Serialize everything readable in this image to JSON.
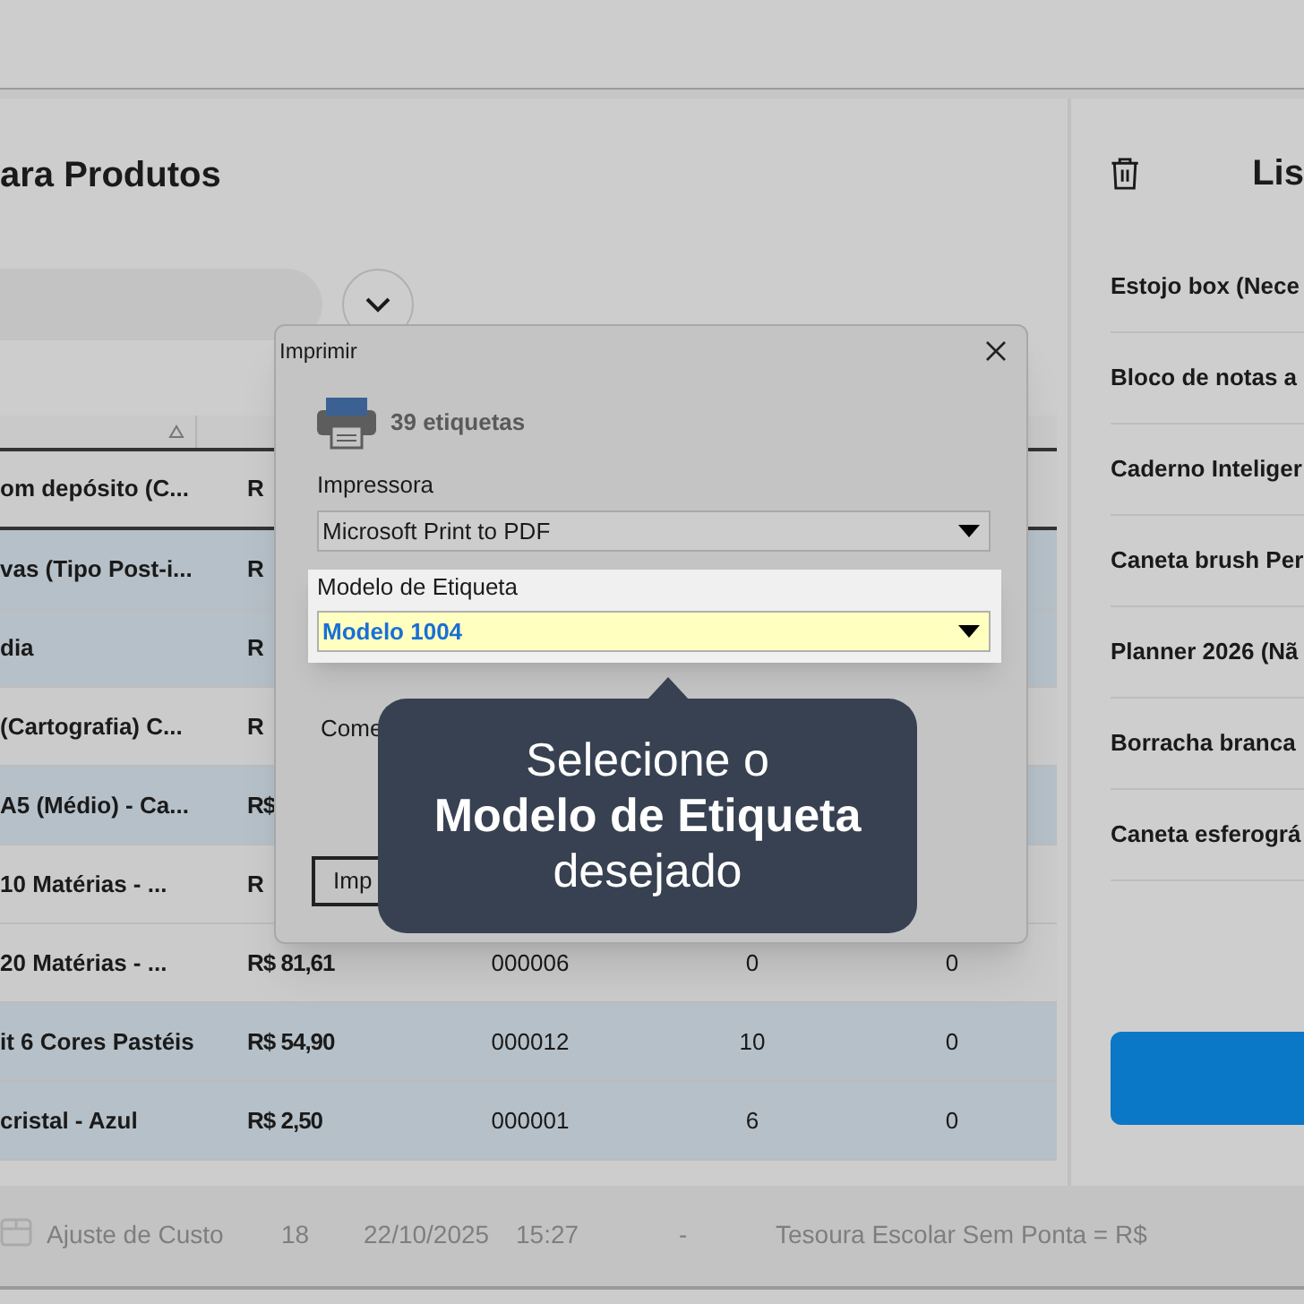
{
  "page_title": "ara Produtos",
  "table": {
    "rows": [
      {
        "name": "om depósito (C...",
        "price": "R",
        "selected": false
      },
      {
        "name": "vas (Tipo Post-i...",
        "price": "R",
        "selected": true
      },
      {
        "name": "dia",
        "price": "R",
        "selected": true
      },
      {
        "name": "(Cartografia) C...",
        "price": "R",
        "selected": false
      },
      {
        "name": "A5 (Médio) - Ca...",
        "price": "R$",
        "selected": true
      },
      {
        "name": "10 Matérias - ...",
        "price": "R",
        "selected": false
      },
      {
        "name": "20 Matérias  - ...",
        "price": "R$ 81,61",
        "code": "000006",
        "qty": "0",
        "column_5": "0",
        "selected": false
      },
      {
        "name": "it 6 Cores Pastéis",
        "price": "R$ 54,90",
        "code": "000012",
        "qty": "10",
        "column_5": "0",
        "selected": true
      },
      {
        "name": "cristal - Azul",
        "price": "R$ 2,50",
        "code": "000001",
        "qty": "6",
        "column_5": "0",
        "selected": true
      }
    ]
  },
  "list_panel": {
    "title": "Lis",
    "items": [
      "Estojo box (Nece",
      "Bloco de notas a",
      "Caderno Inteliger",
      "Caneta brush Per",
      "Planner 2026 (Nã",
      "Borracha branca",
      "Caneta esferográ"
    ]
  },
  "status_row": [
    "Ajuste de Custo",
    "18",
    "22/10/2025",
    "15:27",
    "-",
    "Tesoura Escolar Sem Ponta = R$"
  ],
  "dialog": {
    "title": "Imprimir",
    "count": "39 etiquetas",
    "printer_label": "Impressora",
    "printer_value": "Microsoft Print to PDF",
    "model_label": "Modelo de Etiqueta",
    "model_value": "Modelo 1004",
    "start_label": "Come",
    "print_button": "Imp"
  },
  "tooltip": {
    "lines": [
      "Selecione o",
      "**Modelo de Etiqueta**",
      "desejado"
    ]
  }
}
